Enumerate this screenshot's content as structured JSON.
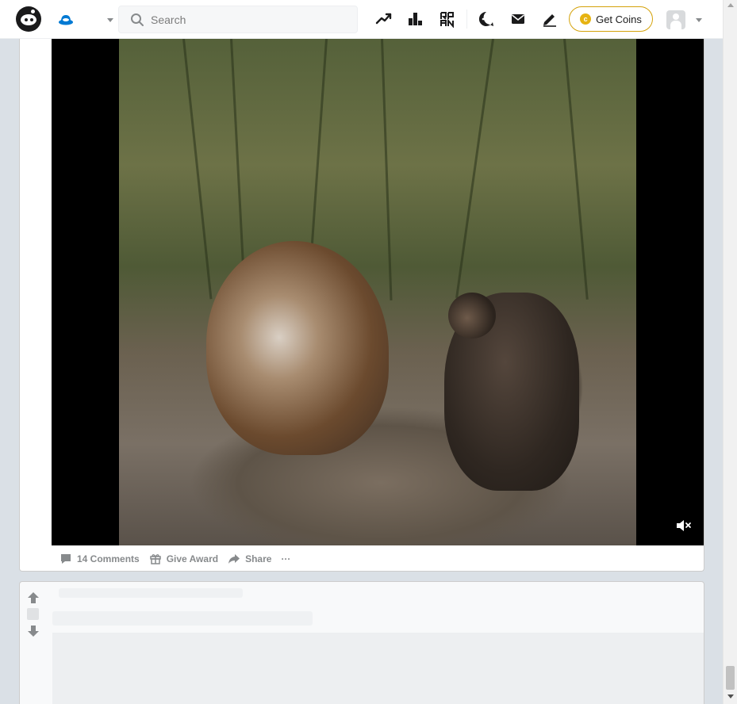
{
  "header": {
    "search_placeholder": "Search",
    "get_coins_label": "Get Coins",
    "coin_symbol": "c"
  },
  "header_icons": [
    "reddit-logo",
    "home-feed-icon",
    "popular-icon",
    "all-icon",
    "rpan-icon",
    "chat-icon",
    "messages-icon",
    "create-post-icon",
    "avatar",
    "user-menu-caret"
  ],
  "post": {
    "comments_label": "14 Comments",
    "award_label": "Give Award",
    "share_label": "Share",
    "more_label": "···",
    "video_muted": true
  },
  "colors": {
    "header_bg": "#ffffff",
    "page_bg": "#dae0e6",
    "action_text": "#878a8c",
    "coins_border": "#d4a20a",
    "coin_fill": "#e6b312",
    "home_blue": "#0079d3"
  }
}
